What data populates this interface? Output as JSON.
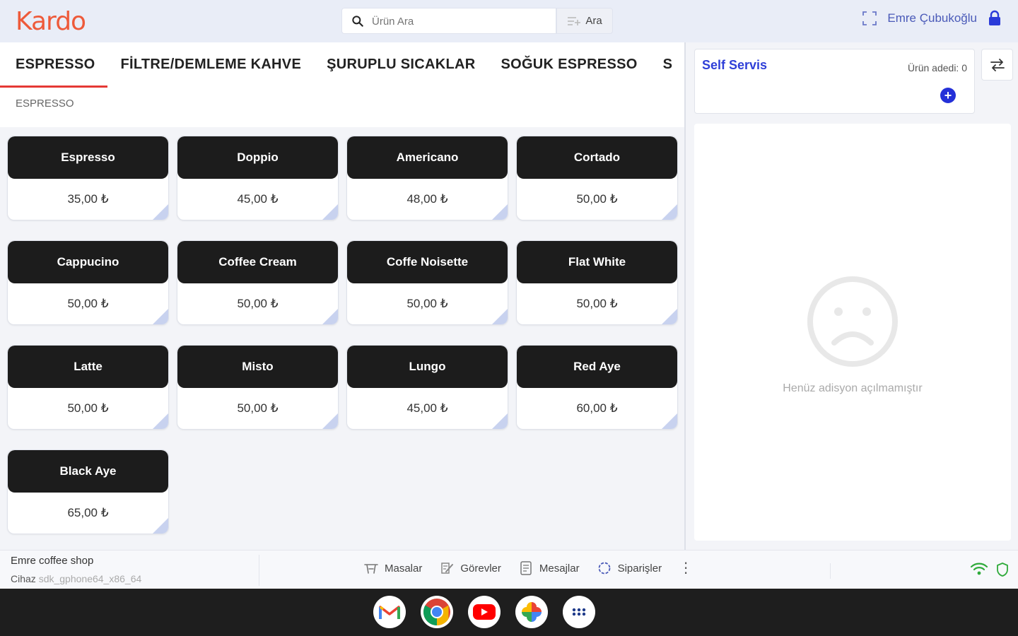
{
  "header": {
    "logo": "Kardo",
    "search_placeholder": "Ürün Ara",
    "search_button": "Ara",
    "user_name": "Emre Çubukoğlu"
  },
  "categories": {
    "tabs": [
      {
        "label": "ESPRESSO",
        "active": true
      },
      {
        "label": "FİLTRE/DEMLEME KAHVE",
        "active": false
      },
      {
        "label": "ŞURUPLU SICAKLAR",
        "active": false
      },
      {
        "label": "SOĞUK ESPRESSO",
        "active": false
      },
      {
        "label": "S",
        "active": false
      }
    ],
    "subcategory": "ESPRESSO"
  },
  "products": [
    {
      "name": "Espresso",
      "price": "35,00 ₺"
    },
    {
      "name": "Doppio",
      "price": "45,00 ₺"
    },
    {
      "name": "Americano",
      "price": "48,00 ₺"
    },
    {
      "name": "Cortado",
      "price": "50,00 ₺"
    },
    {
      "name": "Cappucino",
      "price": "50,00 ₺"
    },
    {
      "name": "Coffee Cream",
      "price": "50,00 ₺"
    },
    {
      "name": "Coffe Noisette",
      "price": "50,00 ₺"
    },
    {
      "name": "Flat White",
      "price": "50,00 ₺"
    },
    {
      "name": "Latte",
      "price": "50,00 ₺"
    },
    {
      "name": "Misto",
      "price": "50,00 ₺"
    },
    {
      "name": "Lungo",
      "price": "45,00 ₺"
    },
    {
      "name": "Red Aye",
      "price": "60,00 ₺"
    },
    {
      "name": "Black Aye",
      "price": "65,00 ₺"
    }
  ],
  "order": {
    "title": "Self Servis",
    "count_label": "Ürün adedi: 0",
    "empty_message": "Henüz adisyon açılmamıştır"
  },
  "statusbar": {
    "shop_name": "Emre coffee shop",
    "device_label": "Cihaz",
    "device_value": "sdk_gphone64_x86_64",
    "nav": [
      {
        "label": "Masalar",
        "icon": "table-icon"
      },
      {
        "label": "Görevler",
        "icon": "tasks-icon"
      },
      {
        "label": "Mesajlar",
        "icon": "messages-icon"
      },
      {
        "label": "Siparişler",
        "icon": "orders-icon"
      }
    ]
  },
  "dock": [
    "Gmail",
    "Chrome",
    "YouTube",
    "Photos",
    "App drawer"
  ],
  "colors": {
    "brand": "#ee5a3a",
    "accent_blue": "#2f3fd8",
    "active_tab_underline": "#e53935",
    "product_header": "#1c1c1c"
  }
}
